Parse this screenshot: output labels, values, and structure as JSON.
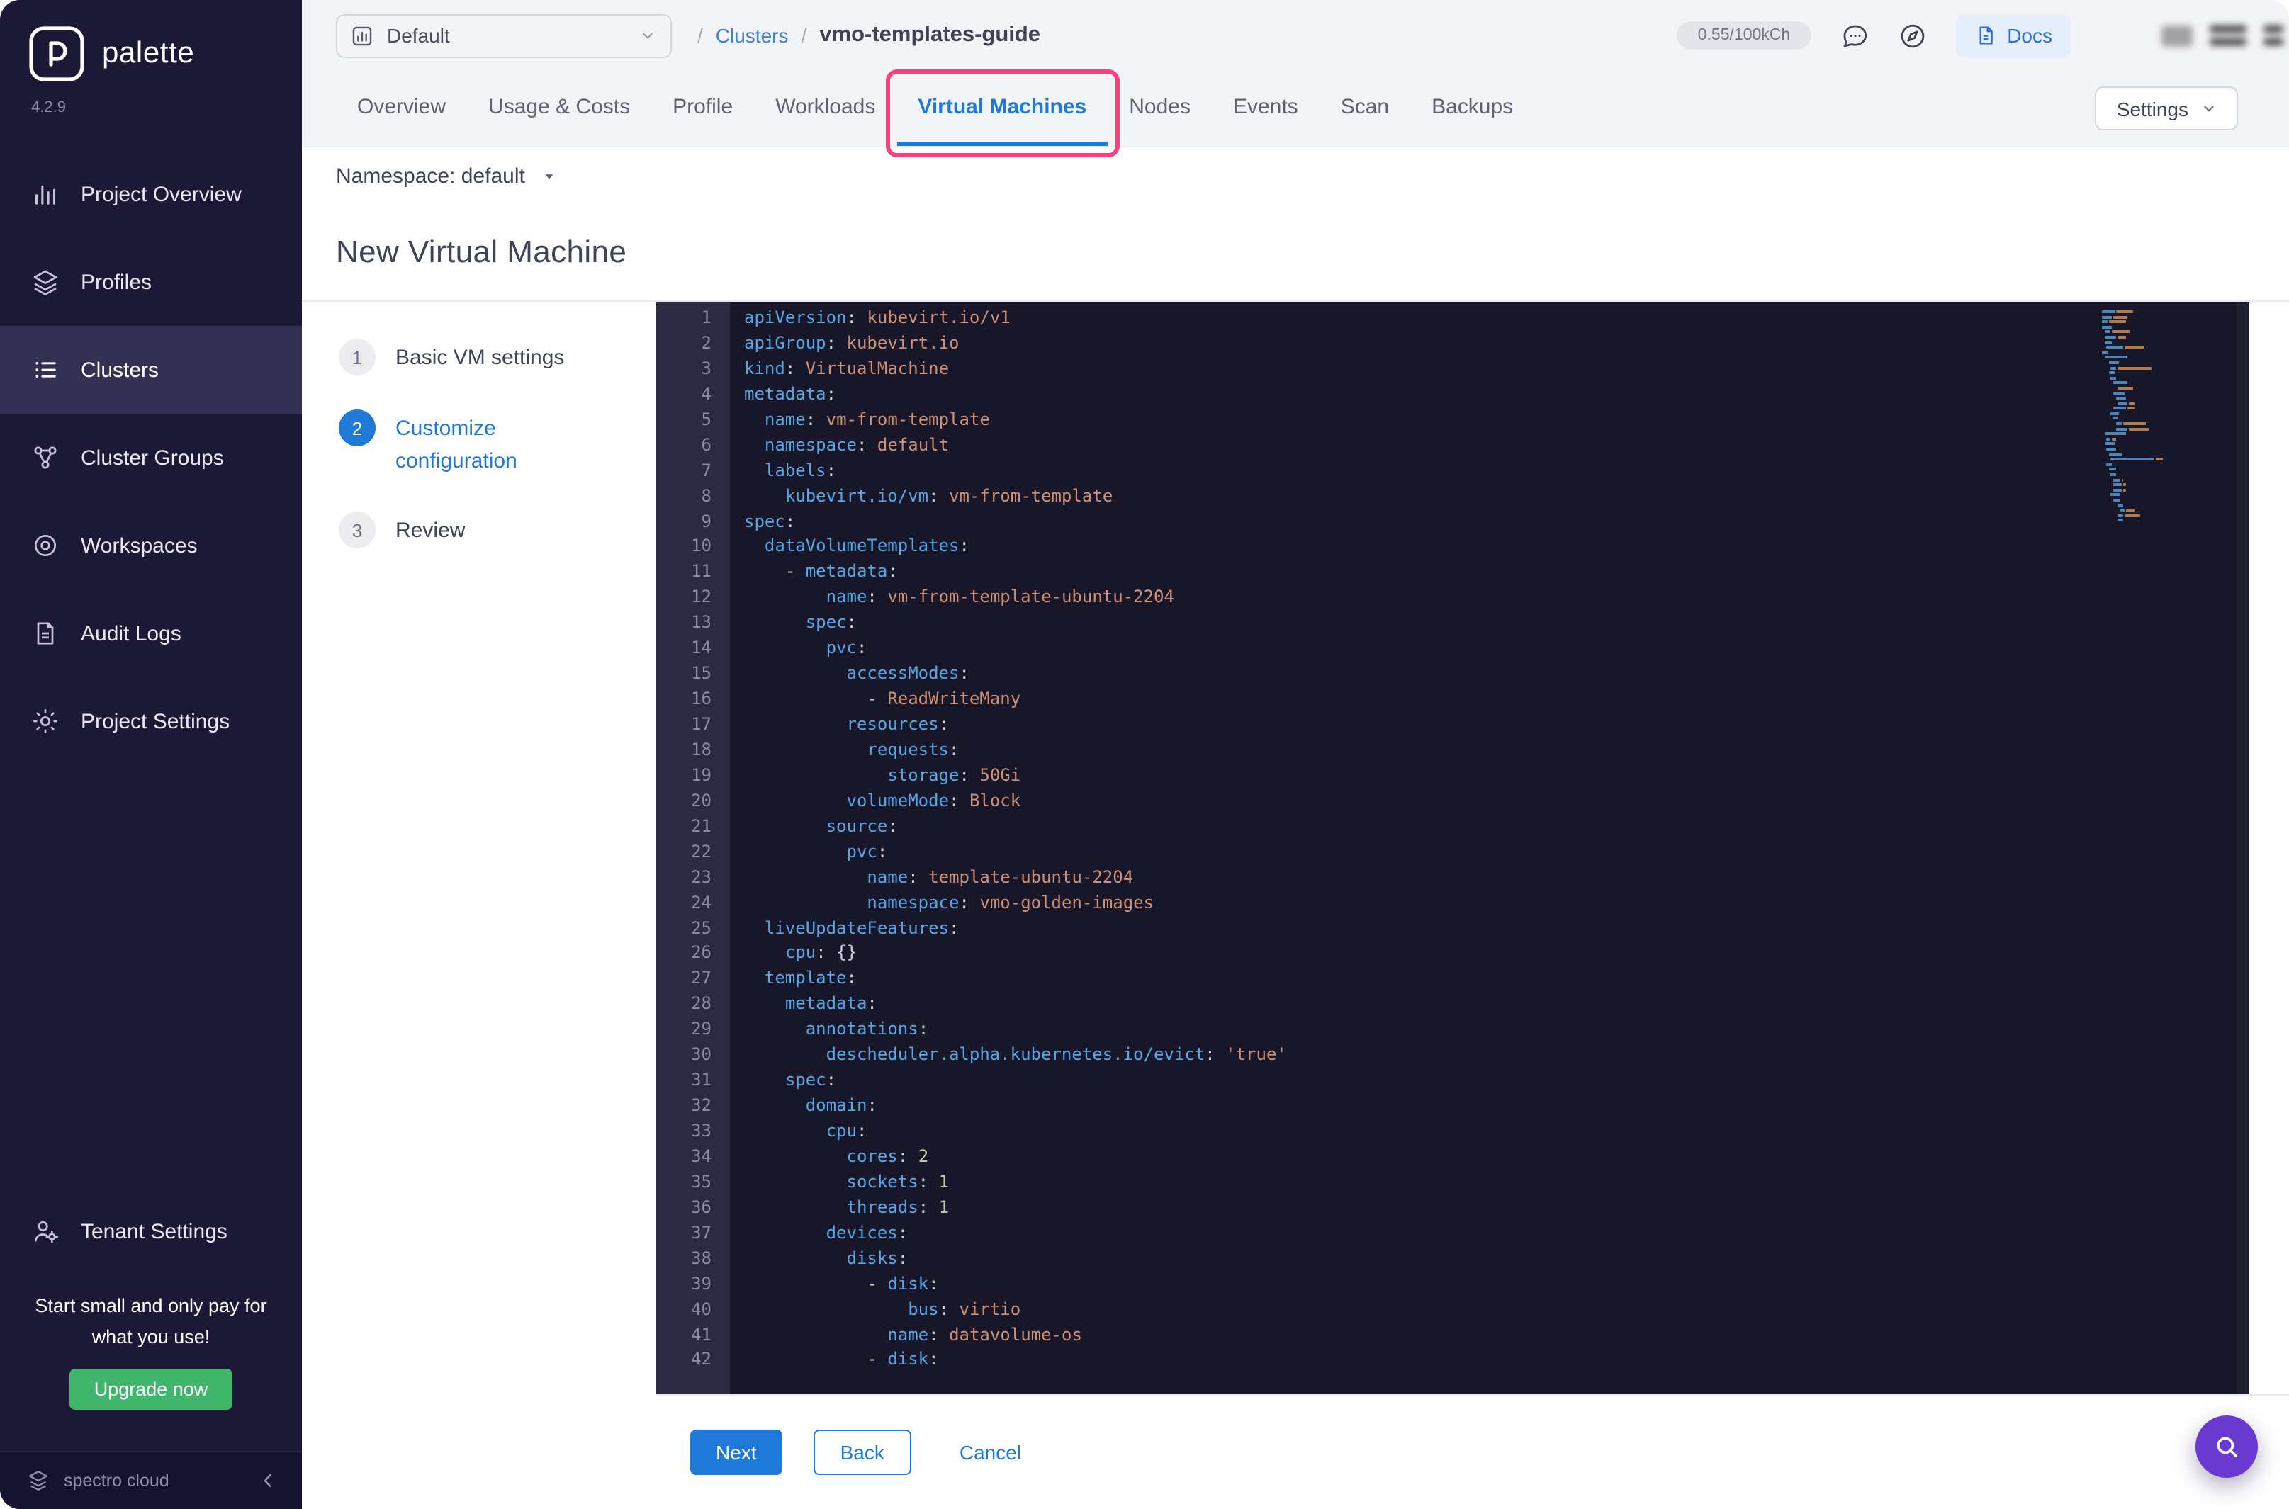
{
  "colors": {
    "accent-blue": "#1E79D8",
    "link-blue": "#3B82D8",
    "highlight-pink": "#F5437E",
    "upgrade-green": "#40B56C",
    "fab-purple": "#6A3AD0",
    "sidebar-bg": "#1C1936",
    "sidebar-active": "#343054",
    "editor-bg": "#181729",
    "gutter-bg": "#2B2A40",
    "yaml-key": "#58A6E4",
    "yaml-string": "#CE9178",
    "yaml-number": "#B5CEA8"
  },
  "sidebar": {
    "logo_text": "palette",
    "version": "4.2.9",
    "items": [
      {
        "label": "Project Overview",
        "icon": "chart-icon",
        "active": false
      },
      {
        "label": "Profiles",
        "icon": "layers-icon",
        "active": false
      },
      {
        "label": "Clusters",
        "icon": "clusters-icon",
        "active": true
      },
      {
        "label": "Cluster Groups",
        "icon": "cluster-groups-icon",
        "active": false
      },
      {
        "label": "Workspaces",
        "icon": "workspaces-icon",
        "active": false
      },
      {
        "label": "Audit Logs",
        "icon": "audit-logs-icon",
        "active": false
      },
      {
        "label": "Project Settings",
        "icon": "gear-icon",
        "active": false
      }
    ],
    "tenant_settings_label": "Tenant Settings",
    "promo_text": "Start small and only pay for what you use!",
    "upgrade_label": "Upgrade now",
    "footer_brand": "spectro cloud"
  },
  "header": {
    "project_selector": "Default",
    "breadcrumb": {
      "root": "Clusters",
      "current": "vmo-templates-guide"
    },
    "usage_pill": "0.55/100kCh",
    "docs_label": "Docs"
  },
  "tabs": {
    "items": [
      "Overview",
      "Usage & Costs",
      "Profile",
      "Workloads",
      "Virtual Machines",
      "Nodes",
      "Events",
      "Scan",
      "Backups"
    ],
    "active": "Virtual Machines",
    "settings_label": "Settings"
  },
  "toolbar": {
    "namespace_label": "Namespace: default"
  },
  "page": {
    "title": "New Virtual Machine"
  },
  "stepper": [
    {
      "num": "1",
      "label": "Basic VM settings",
      "state": "default"
    },
    {
      "num": "2",
      "label": "Customize configuration",
      "state": "active"
    },
    {
      "num": "3",
      "label": "Review",
      "state": "default"
    }
  ],
  "editor": {
    "lines": [
      {
        "n": 1,
        "i": 0,
        "k": "apiVersion",
        "v": "kubevirt.io/v1",
        "t": "s"
      },
      {
        "n": 2,
        "i": 0,
        "k": "apiGroup",
        "v": "kubevirt.io",
        "t": "s"
      },
      {
        "n": 3,
        "i": 0,
        "k": "kind",
        "v": "VirtualMachine",
        "t": "s"
      },
      {
        "n": 4,
        "i": 0,
        "k": "metadata"
      },
      {
        "n": 5,
        "i": 2,
        "k": "name",
        "v": "vm-from-template",
        "t": "s"
      },
      {
        "n": 6,
        "i": 2,
        "k": "namespace",
        "v": "default",
        "t": "s"
      },
      {
        "n": 7,
        "i": 2,
        "k": "labels"
      },
      {
        "n": 8,
        "i": 4,
        "k": "kubevirt.io/vm",
        "v": "vm-from-template",
        "t": "s"
      },
      {
        "n": 9,
        "i": 0,
        "k": "spec"
      },
      {
        "n": 10,
        "i": 2,
        "k": "dataVolumeTemplates"
      },
      {
        "n": 11,
        "i": 4,
        "d": 1,
        "k": "metadata"
      },
      {
        "n": 12,
        "i": 8,
        "k": "name",
        "v": "vm-from-template-ubuntu-2204",
        "t": "s"
      },
      {
        "n": 13,
        "i": 6,
        "k": "spec"
      },
      {
        "n": 14,
        "i": 8,
        "k": "pvc"
      },
      {
        "n": 15,
        "i": 10,
        "k": "accessModes"
      },
      {
        "n": 16,
        "i": 12,
        "d": 1,
        "v": "ReadWriteMany",
        "t": "s"
      },
      {
        "n": 17,
        "i": 10,
        "k": "resources"
      },
      {
        "n": 18,
        "i": 12,
        "k": "requests"
      },
      {
        "n": 19,
        "i": 14,
        "k": "storage",
        "v": "50Gi",
        "t": "s"
      },
      {
        "n": 20,
        "i": 10,
        "k": "volumeMode",
        "v": "Block",
        "t": "s"
      },
      {
        "n": 21,
        "i": 8,
        "k": "source"
      },
      {
        "n": 22,
        "i": 10,
        "k": "pvc"
      },
      {
        "n": 23,
        "i": 12,
        "k": "name",
        "v": "template-ubuntu-2204",
        "t": "s"
      },
      {
        "n": 24,
        "i": 12,
        "k": "namespace",
        "v": "vmo-golden-images",
        "t": "s"
      },
      {
        "n": 25,
        "i": 2,
        "k": "liveUpdateFeatures"
      },
      {
        "n": 26,
        "i": 4,
        "k": "cpu",
        "v": "{}",
        "t": "p"
      },
      {
        "n": 27,
        "i": 2,
        "k": "template"
      },
      {
        "n": 28,
        "i": 4,
        "k": "metadata"
      },
      {
        "n": 29,
        "i": 6,
        "k": "annotations"
      },
      {
        "n": 30,
        "i": 8,
        "k": "descheduler.alpha.kubernetes.io/evict",
        "v": "'true'",
        "t": "s"
      },
      {
        "n": 31,
        "i": 4,
        "k": "spec"
      },
      {
        "n": 32,
        "i": 6,
        "k": "domain"
      },
      {
        "n": 33,
        "i": 8,
        "k": "cpu"
      },
      {
        "n": 34,
        "i": 10,
        "k": "cores",
        "v": "2",
        "t": "n"
      },
      {
        "n": 35,
        "i": 10,
        "k": "sockets",
        "v": "1",
        "t": "n"
      },
      {
        "n": 36,
        "i": 10,
        "k": "threads",
        "v": "1",
        "t": "n"
      },
      {
        "n": 37,
        "i": 8,
        "k": "devices"
      },
      {
        "n": 38,
        "i": 10,
        "k": "disks"
      },
      {
        "n": 39,
        "i": 12,
        "d": 1,
        "k": "disk"
      },
      {
        "n": 40,
        "i": 16,
        "k": "bus",
        "v": "virtio",
        "t": "s"
      },
      {
        "n": 41,
        "i": 14,
        "k": "name",
        "v": "datavolume-os",
        "t": "s"
      },
      {
        "n": 42,
        "i": 12,
        "d": 1,
        "k": "disk"
      }
    ]
  },
  "footer": {
    "next": "Next",
    "back": "Back",
    "cancel": "Cancel"
  }
}
